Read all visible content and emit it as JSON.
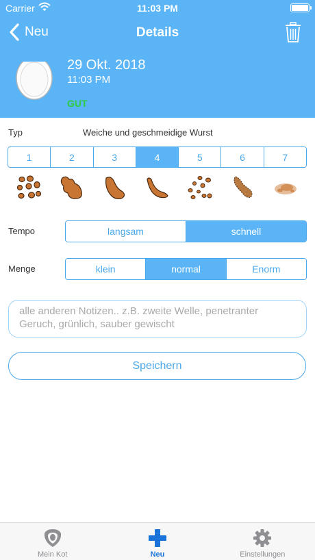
{
  "status": {
    "carrier": "Carrier",
    "time": "11:03 PM"
  },
  "nav": {
    "back_label": "Neu",
    "title": "Details"
  },
  "entry": {
    "date": "29 Okt. 2018",
    "time": "11:03 PM",
    "rating": "GUT"
  },
  "type": {
    "label": "Typ",
    "description": "Weiche und geschmeidige Wurst",
    "options": [
      "1",
      "2",
      "3",
      "4",
      "5",
      "6",
      "7"
    ],
    "selected_index": 3
  },
  "tempo": {
    "label": "Tempo",
    "options": [
      "langsam",
      "schnell"
    ],
    "selected_index": 1
  },
  "menge": {
    "label": "Menge",
    "options": [
      "klein",
      "normal",
      "Enorm"
    ],
    "selected_index": 1
  },
  "notes": {
    "placeholder": "alle anderen Notizen.. z.B. zweite Welle, penetranter Geruch, grünlich, sauber gewischt",
    "value": ""
  },
  "save_label": "Speichern",
  "tabs": [
    {
      "label": "Mein Kot",
      "icon": "shield-icon",
      "active": false
    },
    {
      "label": "Neu",
      "icon": "plus-icon",
      "active": true
    },
    {
      "label": "Einstellungen",
      "icon": "gear-icon",
      "active": false
    }
  ],
  "colors": {
    "accent": "#5ab4f5",
    "segment_border": "#4aa8ea",
    "rating": "#2ecc40",
    "stool_brown": "#c87533",
    "tab_active": "#1a73d9"
  }
}
